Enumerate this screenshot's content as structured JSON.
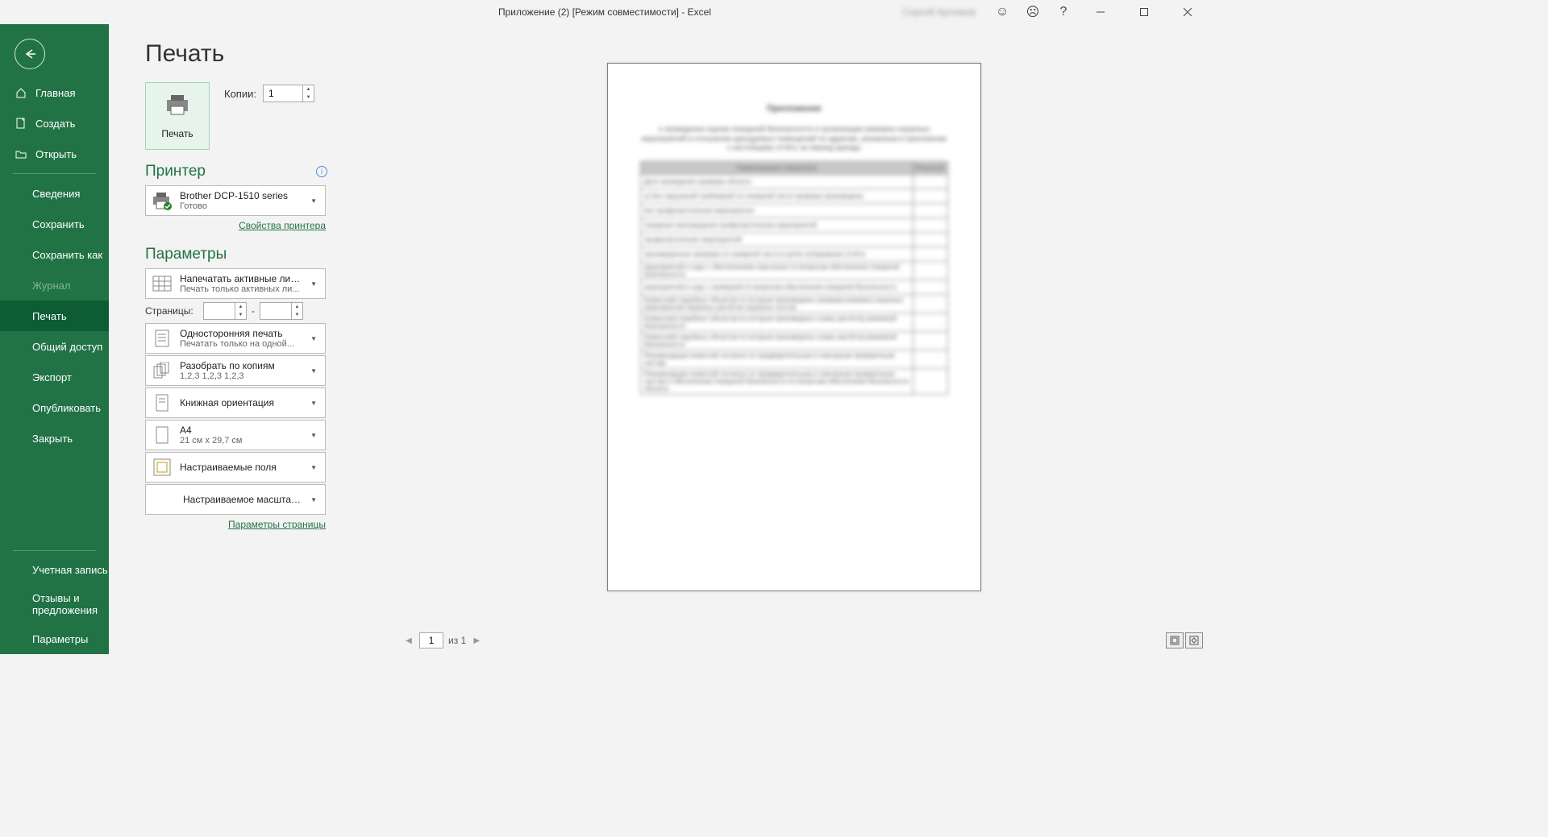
{
  "titlebar": {
    "title": "Приложение (2)  [Режим совместимости]  -  Excel",
    "user": "Сергей Артемов"
  },
  "sidebar": {
    "home": "Главная",
    "new": "Создать",
    "open": "Открыть",
    "info": "Сведения",
    "save": "Сохранить",
    "saveas": "Сохранить как",
    "history": "Журнал",
    "print": "Печать",
    "share": "Общий доступ",
    "export": "Экспорт",
    "publish": "Опубликовать",
    "close": "Закрыть",
    "account": "Учетная запись",
    "feedback": "Отзывы и предложения",
    "options": "Параметры"
  },
  "print": {
    "title": "Печать",
    "btn": "Печать",
    "copies_label": "Копии:",
    "copies_value": "1",
    "printer_section": "Принтер",
    "printer_name": "Brother DCP-1510 series",
    "printer_status": "Готово",
    "printer_props": "Свойства принтера",
    "settings_section": "Параметры",
    "setting_sheets_l1": "Напечатать активные листы",
    "setting_sheets_l2": "Печать только активных ли...",
    "pages_label": "Страницы:",
    "pages_from": "",
    "pages_to": "",
    "setting_sides_l1": "Односторонняя печать",
    "setting_sides_l2": "Печатать только на одной...",
    "setting_collate_l1": "Разобрать по копиям",
    "setting_collate_l2": "1,2,3    1,2,3    1,2,3",
    "setting_orient": "Книжная ориентация",
    "setting_paper_l1": "A4",
    "setting_paper_l2": "21 см x 29,7 см",
    "setting_margins": "Настраиваемые поля",
    "setting_scale": "Настраиваемое масштаби...",
    "page_setup": "Параметры страницы"
  },
  "preview": {
    "page_current": "1",
    "page_of": "из 1",
    "doc_heading": "Приложение"
  }
}
